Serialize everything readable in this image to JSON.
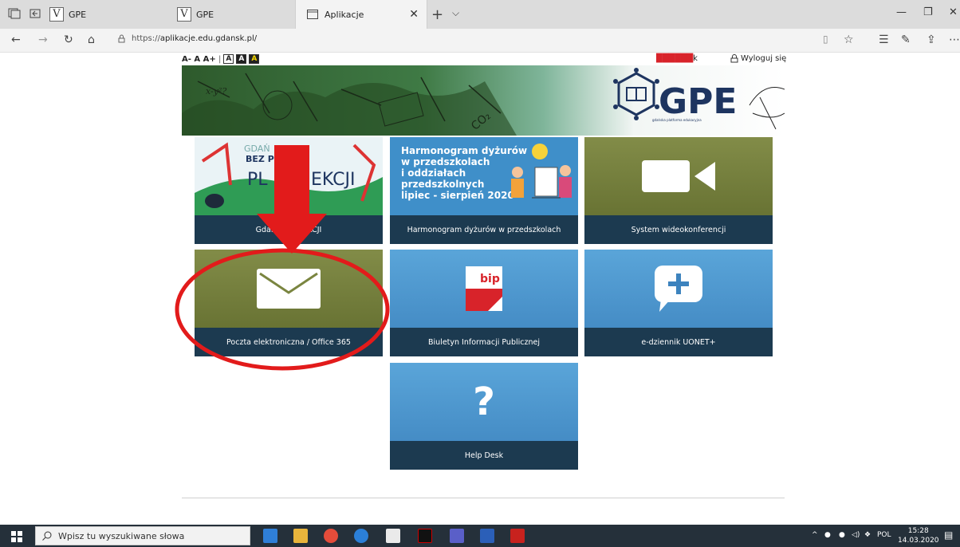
{
  "browser": {
    "tabs": [
      {
        "label": "GPE"
      },
      {
        "label": "GPE"
      },
      {
        "label": "Aplikacje"
      }
    ],
    "url_prefix": "https://",
    "url_host": "aplikacje.edu.gdansk.pl/"
  },
  "page": {
    "font_controls": "A- A A+",
    "contrast_boxes": [
      "A",
      "A",
      "A"
    ],
    "user_name_redacted": "██████",
    "user_name_suffix": "k",
    "logout_label": "Wyloguj się",
    "brand": "GPE",
    "brand_sub": "gdańska platforma edukacyjna"
  },
  "tiles": [
    {
      "caption": "Gdański ... LEKCJI",
      "art_lines": [
        "GDAŃ",
        "BEZ P",
        "PL",
        "EKCJI"
      ]
    },
    {
      "caption": "Harmonogram dyżurów w przedszkolach",
      "art_lines": [
        "Harmonogram dyżurów",
        "w przedszkolach",
        "i oddziałach",
        "przedszkolnych",
        "lipiec - sierpień 2020"
      ]
    },
    {
      "caption": "System wideokonferencji"
    },
    {
      "caption": "Poczta elektroniczna / Office 365"
    },
    {
      "caption": "Biuletyn Informacji Publicznej",
      "badge": "bip"
    },
    {
      "caption": "e-dziennik UONET+"
    },
    {
      "caption": "Help Desk"
    }
  ],
  "taskbar": {
    "search_placeholder": "Wpisz tu wyszukiwane słowa",
    "lang": "POL",
    "time": "15:28",
    "date": "14.03.2020"
  },
  "colors": {
    "olive": "#6f7a3a",
    "blue": "#4a93cc",
    "caption": "#1c3a50",
    "annotation_red": "#e21b1b"
  }
}
